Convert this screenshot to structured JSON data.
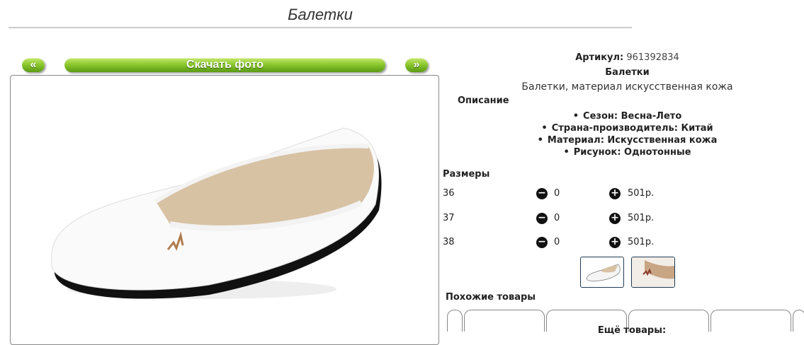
{
  "page": {
    "title": "Балетки"
  },
  "gallery": {
    "prev_label": "«",
    "download_label": "Скачать фото",
    "next_label": "»"
  },
  "product": {
    "sku_label": "Артикул:",
    "sku_value": "961392834",
    "name": "Балетки",
    "description": "Балетки, материал искусственная кожа",
    "description_heading": "Описание",
    "features": [
      "Сезон: Весна-Лето",
      "Страна-производитель: Китай",
      "Материал: Искусственная кожа",
      "Рисунок: Однотонные"
    ]
  },
  "sizes": {
    "heading": "Размеры",
    "rows": [
      {
        "size": "36",
        "qty": "0",
        "price": "501р."
      },
      {
        "size": "37",
        "qty": "0",
        "price": "501р."
      },
      {
        "size": "38",
        "qty": "0",
        "price": "501р."
      }
    ],
    "minus_icon": "minus-circle-icon",
    "plus_icon": "plus-circle-icon"
  },
  "similar": {
    "heading": "Похожие товары",
    "more_label": "Ещё товары:"
  },
  "colors": {
    "button_green": "#8cc92e",
    "thumb_border": "#1f3a55"
  }
}
